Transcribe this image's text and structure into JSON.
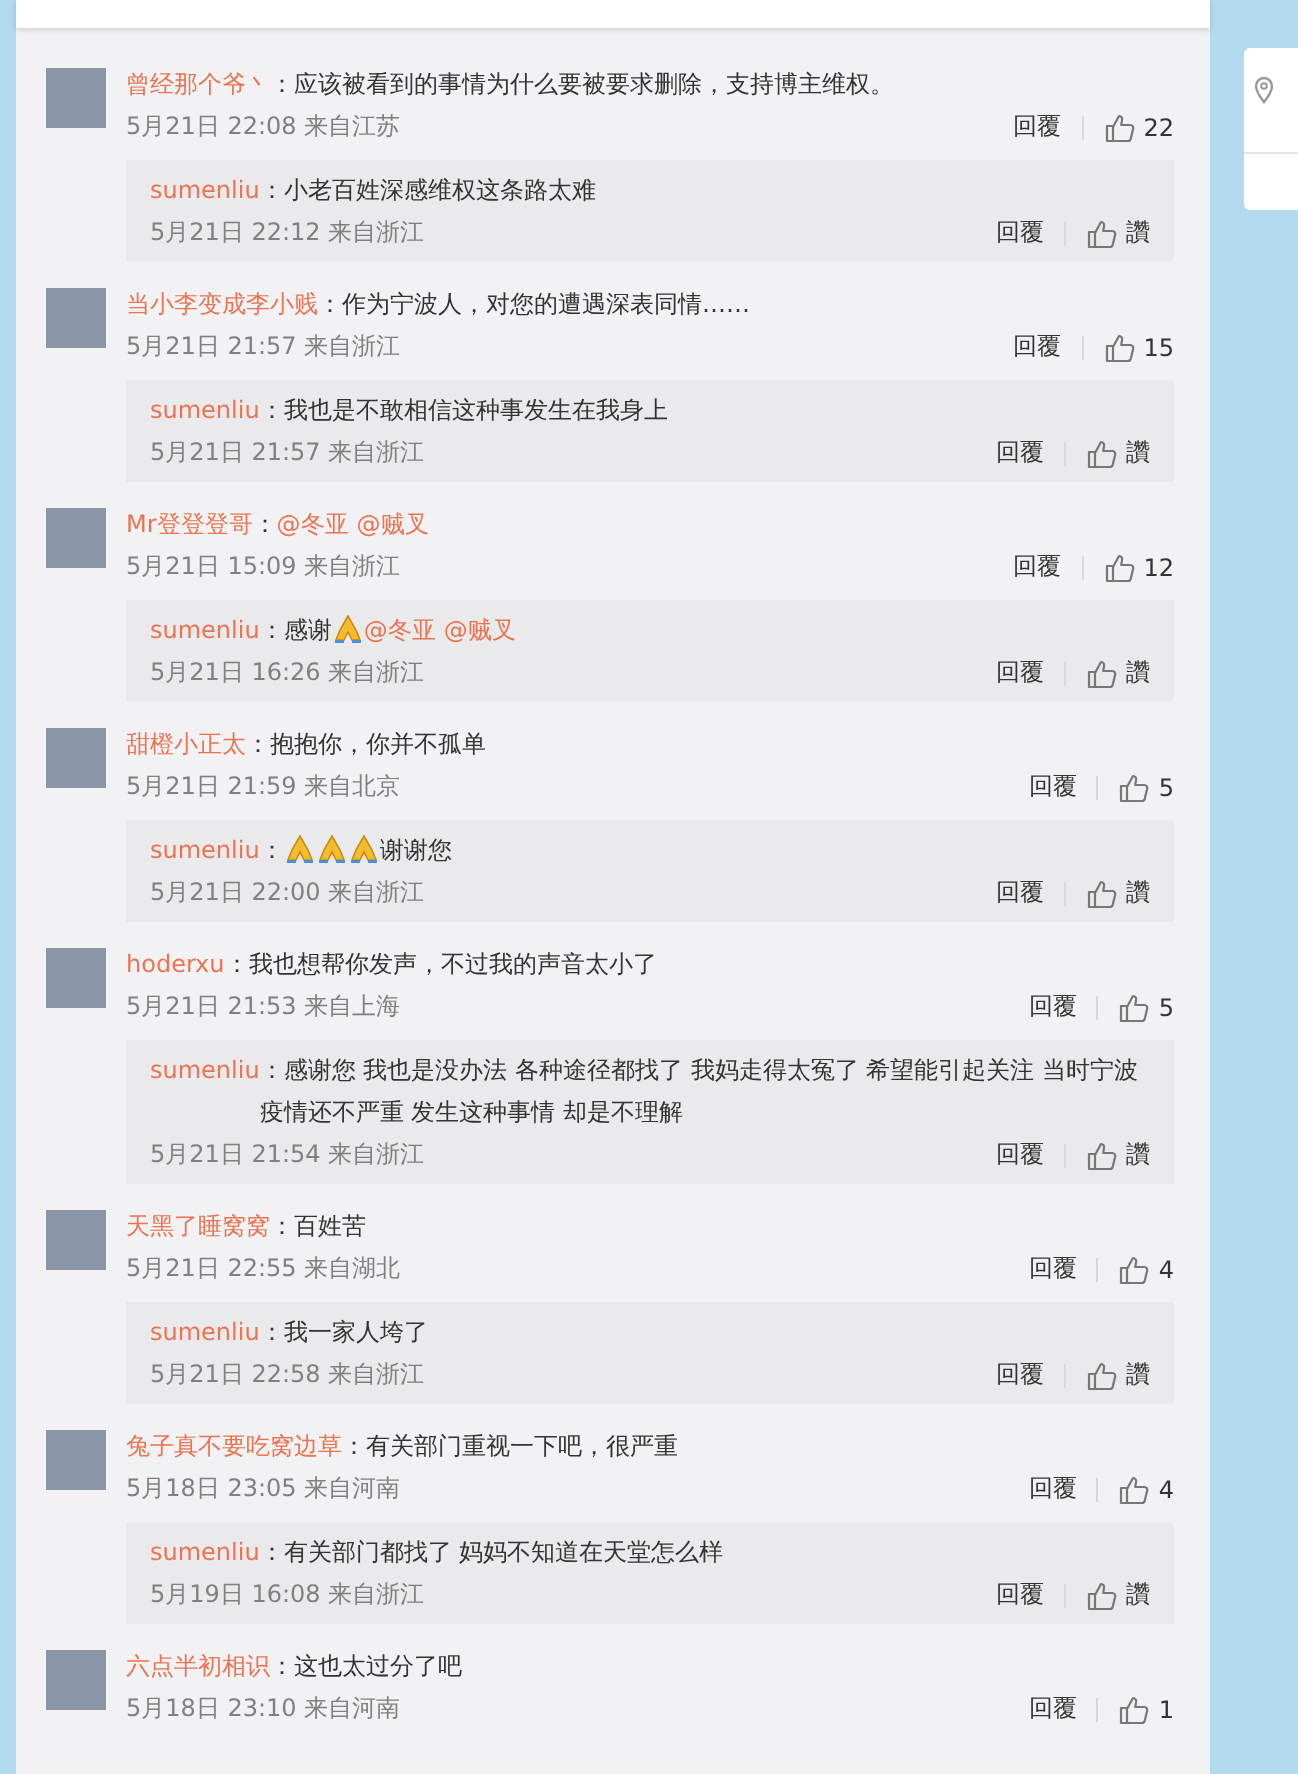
{
  "comments": [
    {
      "author": "曾经那个爷丶",
      "body": [
        {
          "kind": "text",
          "text": "：应该被看到的事情为什么要被要求删除，支持博主维权。"
        }
      ],
      "time": "5月21日 22:08 来自江苏",
      "reply_label": "回覆",
      "likes": "22",
      "reply": {
        "author": "sumenliu",
        "body": [
          {
            "kind": "text",
            "text": "：小老百姓深感维权这条路太难"
          }
        ],
        "time": "5月21日 22:12 来自浙江",
        "reply_label": "回覆",
        "likes": "讚"
      }
    },
    {
      "author": "当小李变成李小贱",
      "body": [
        {
          "kind": "text",
          "text": "：作为宁波人，对您的遭遇深表同情……"
        }
      ],
      "time": "5月21日 21:57 来自浙江",
      "reply_label": "回覆",
      "likes": "15",
      "reply": {
        "author": "sumenliu",
        "body": [
          {
            "kind": "text",
            "text": "：我也是不敢相信这种事发生在我身上"
          }
        ],
        "time": "5月21日 21:57 来自浙江",
        "reply_label": "回覆",
        "likes": "讚"
      }
    },
    {
      "author": "Mr登登登哥",
      "body": [
        {
          "kind": "text",
          "text": "："
        },
        {
          "kind": "mention",
          "text": "@冬亚"
        },
        {
          "kind": "mention",
          "text": "@贼叉"
        }
      ],
      "time": "5月21日 15:09 来自浙江",
      "reply_label": "回覆",
      "likes": "12",
      "reply": {
        "author": "sumenliu",
        "body": [
          {
            "kind": "text",
            "text": "：感谢"
          },
          {
            "kind": "emoji"
          },
          {
            "kind": "mention",
            "text": "@冬亚"
          },
          {
            "kind": "mention",
            "text": "@贼叉"
          }
        ],
        "time": "5月21日 16:26 来自浙江",
        "reply_label": "回覆",
        "likes": "讚"
      }
    },
    {
      "author": "甜橙小正太",
      "body": [
        {
          "kind": "text",
          "text": "：抱抱你，你并不孤单"
        }
      ],
      "time": "5月21日 21:59 来自北京",
      "reply_label": "回覆",
      "likes": "5",
      "reply": {
        "author": "sumenliu",
        "body": [
          {
            "kind": "text",
            "text": "："
          },
          {
            "kind": "emoji"
          },
          {
            "kind": "emoji"
          },
          {
            "kind": "emoji"
          },
          {
            "kind": "text",
            "text": "谢谢您"
          }
        ],
        "time": "5月21日 22:00 来自浙江",
        "reply_label": "回覆",
        "likes": "讚"
      }
    },
    {
      "author": "hoderxu",
      "body": [
        {
          "kind": "text",
          "text": "：我也想帮你发声，不过我的声音太小了"
        }
      ],
      "time": "5月21日 21:53 来自上海",
      "reply_label": "回覆",
      "likes": "5",
      "reply": {
        "author": "sumenliu",
        "body": [
          {
            "kind": "text",
            "text": "：感谢您 我也是没办法 各种途径都找了 我妈走得太冤了 希望能引起关注 当时宁波疫情还不严重 发生这种事情 却是不理解"
          }
        ],
        "time": "5月21日 21:54 来自浙江",
        "reply_label": "回覆",
        "likes": "讚"
      }
    },
    {
      "author": "天黑了睡窝窝",
      "body": [
        {
          "kind": "text",
          "text": "：百姓苦"
        }
      ],
      "time": "5月21日 22:55 来自湖北",
      "reply_label": "回覆",
      "likes": "4",
      "reply": {
        "author": "sumenliu",
        "body": [
          {
            "kind": "text",
            "text": "：我一家人垮了"
          }
        ],
        "time": "5月21日 22:58 来自浙江",
        "reply_label": "回覆",
        "likes": "讚"
      }
    },
    {
      "author": "兔子真不要吃窝边草",
      "body": [
        {
          "kind": "text",
          "text": "：有关部门重视一下吧，很严重"
        }
      ],
      "time": "5月18日 23:05 来自河南",
      "reply_label": "回覆",
      "likes": "4",
      "reply": {
        "author": "sumenliu",
        "body": [
          {
            "kind": "text",
            "text": "：有关部门都找了 妈妈不知道在天堂怎么样"
          }
        ],
        "time": "5月19日 16:08 来自浙江",
        "reply_label": "回覆",
        "likes": "讚"
      }
    },
    {
      "author": "六点半初相识",
      "body": [
        {
          "kind": "text",
          "text": "：这也太过分了吧"
        }
      ],
      "time": "5月18日 23:10 来自河南",
      "reply_label": "回覆",
      "likes": "1"
    }
  ]
}
